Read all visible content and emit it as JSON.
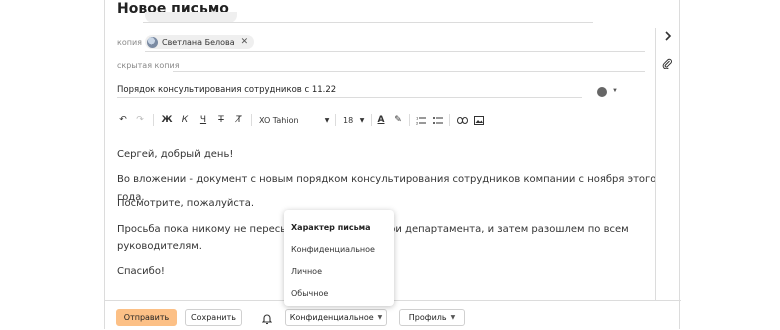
{
  "window": {
    "title": "Новое письмо"
  },
  "cc": {
    "label": "копия",
    "recipient": "Светлана Белова",
    "remove_icon": "close-icon"
  },
  "bcc": {
    "label": "скрытая копия"
  },
  "subject": {
    "value": "Порядок консультирования сотрудников с 11.22",
    "color_tag": "#666666"
  },
  "toolbar": {
    "undo": "↶",
    "redo": "↷",
    "bold": "Ж",
    "italic": "К",
    "underline": "Ч",
    "strike": "Т",
    "clear": "T̸",
    "font": "XO Tahion",
    "size": "18",
    "text_color": "A",
    "highlight": "✎"
  },
  "body": {
    "lines": [
      "Сергей, добрый день!",
      "Во вложении - документ с новым порядком консультирования сотрудников компании с ноября этого года.",
      "Посмотрите, пожалуйста.",
      "Просьба пока никому не пересылать",
      "ри департамента, и затем разошлем по всем",
      "руководителям.",
      "Спасибо!"
    ]
  },
  "footer": {
    "send": "Отправить",
    "save": "Сохранить",
    "confidentiality": "Конфиденциальное",
    "profile": "Профиль"
  },
  "dropdown": {
    "header": "Характер письма",
    "options": [
      "Конфиденциальное",
      "Личное",
      "Обычное"
    ]
  },
  "colors": {
    "accent": "#fcc086",
    "border": "#dcdcdc"
  }
}
